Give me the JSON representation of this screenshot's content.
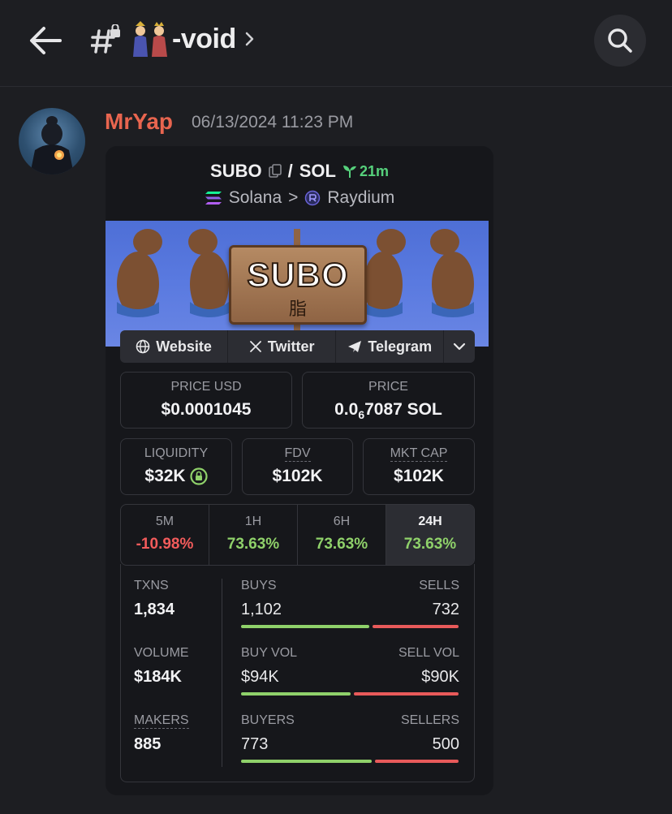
{
  "header": {
    "channel_name": "-void",
    "icons": {
      "back": "arrow-left-icon",
      "channel": "locked-text-channel-icon",
      "chevron": "chevron-right-icon",
      "search": "search-icon"
    }
  },
  "message": {
    "author": "MrYap",
    "author_color": "#e8654f",
    "timestamp": "06/13/2024 11:23 PM"
  },
  "card": {
    "base_token": "SUBO",
    "separator": "/",
    "quote_token": "SOL",
    "age": "21m",
    "chain": "Solana",
    "chain_sep": ">",
    "dex": "Raydium",
    "banner": {
      "title": "SUBO",
      "subtitle": "脂"
    },
    "links": [
      {
        "label": "Website",
        "icon": "globe-icon"
      },
      {
        "label": "Twitter",
        "icon": "x-logo-icon"
      },
      {
        "label": "Telegram",
        "icon": "telegram-icon"
      }
    ],
    "price_usd": {
      "label": "PRICE USD",
      "value": "$0.0001045"
    },
    "price_native": {
      "label": "PRICE",
      "prefix": "0.0",
      "subscript": "6",
      "suffix": "7087 SOL"
    },
    "liquidity": {
      "label": "LIQUIDITY",
      "value": "$32K"
    },
    "fdv": {
      "label": "FDV",
      "value": "$102K"
    },
    "mkt_cap": {
      "label": "MKT CAP",
      "value": "$102K"
    },
    "timeframes": [
      {
        "label": "5M",
        "value": "-10.98%",
        "color": "#f25b5b",
        "selected": false
      },
      {
        "label": "1H",
        "value": "73.63%",
        "color": "#8fd16a",
        "selected": false
      },
      {
        "label": "6H",
        "value": "73.63%",
        "color": "#8fd16a",
        "selected": false
      },
      {
        "label": "24H",
        "value": "73.63%",
        "color": "#8fd16a",
        "selected": true
      }
    ],
    "stats": {
      "txns": {
        "label": "TXNS",
        "value": "1,834"
      },
      "volume": {
        "label": "VOLUME",
        "value": "$184K"
      },
      "makers": {
        "label": "MAKERS",
        "value": "885"
      },
      "buys": {
        "label": "BUYS",
        "value": "1,102"
      },
      "sells": {
        "label": "SELLS",
        "value": "732"
      },
      "buy_vol": {
        "label": "BUY VOL",
        "value": "$94K"
      },
      "sell_vol": {
        "label": "SELL VOL",
        "value": "$90K"
      },
      "buyers": {
        "label": "BUYERS",
        "value": "773"
      },
      "sellers": {
        "label": "SELLERS",
        "value": "500"
      },
      "buys_share": 0.6,
      "buy_vol_share": 0.51,
      "buyers_share": 0.61,
      "buy_color": "#8fd16a",
      "sell_color": "#e85a5a"
    }
  }
}
